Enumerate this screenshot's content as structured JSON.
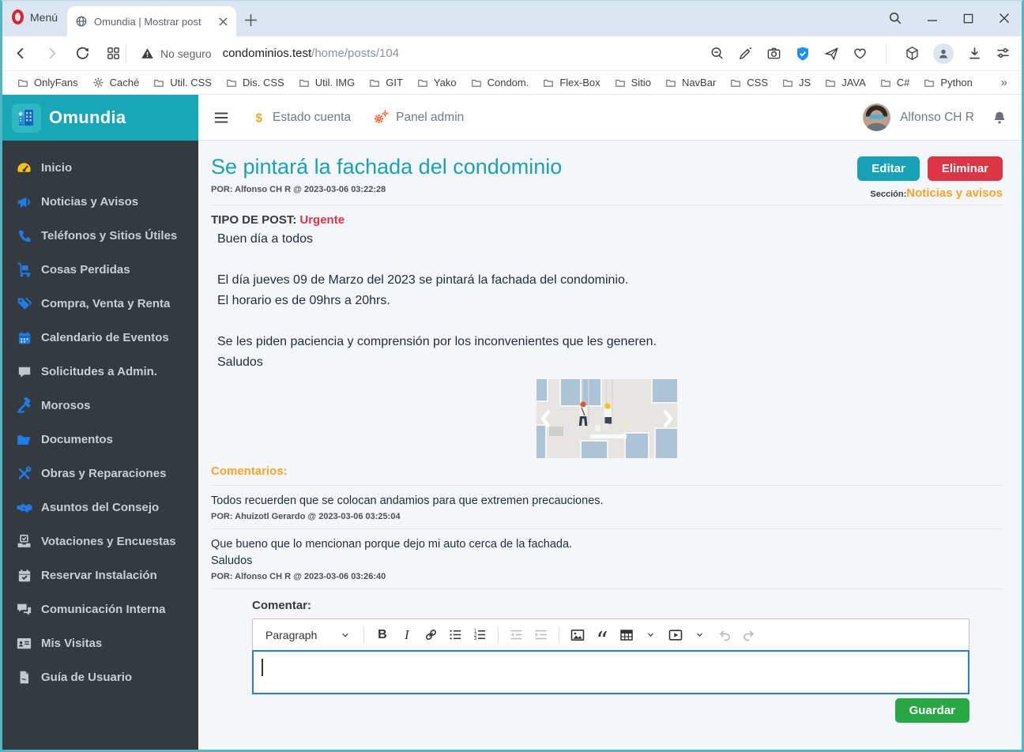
{
  "browser": {
    "menu_button": "Menú",
    "tab_title": "Omundia | Mostrar post",
    "security_label": "No seguro",
    "url_host": "condominios.test",
    "url_path": "/home/posts/104",
    "bookmarks": [
      "OnlyFans",
      "Caché",
      "Util. CSS",
      "Dis. CSS",
      "Util. IMG",
      "GIT",
      "Yako",
      "Condom.",
      "Flex-Box",
      "Sitio",
      "NavBar",
      "CSS",
      "JS",
      "JAVA",
      "C#",
      "Python"
    ],
    "bookmarks_overflow": "»"
  },
  "sidebar": {
    "brand": "Omundia",
    "items": [
      {
        "label": "Inicio"
      },
      {
        "label": "Noticias y Avisos"
      },
      {
        "label": "Teléfonos y Sitios Útiles"
      },
      {
        "label": "Cosas Perdidas"
      },
      {
        "label": "Compra, Venta y Renta"
      },
      {
        "label": "Calendario de Eventos"
      },
      {
        "label": "Solicitudes a Admin."
      },
      {
        "label": "Morosos"
      },
      {
        "label": "Documentos"
      },
      {
        "label": "Obras y Reparaciones"
      },
      {
        "label": "Asuntos del Consejo"
      },
      {
        "label": "Votaciones y Encuestas"
      },
      {
        "label": "Reservar Instalación"
      },
      {
        "label": "Comunicación Interna"
      },
      {
        "label": "Mis Visitas"
      },
      {
        "label": "Guía de Usuario"
      }
    ]
  },
  "navbar": {
    "links": [
      {
        "label": "Estado cuenta"
      },
      {
        "label": "Panel admin"
      }
    ],
    "user_name": "Alfonso CH R"
  },
  "post": {
    "title": "Se pintará la fachada del condominio",
    "byline": "POR: Alfonso CH R @ 2023-03-06 03:22:28",
    "edit_label": "Editar",
    "delete_label": "Eliminar",
    "section_label": "Sección:",
    "section_value": "Noticias y avisos",
    "type_label": "TIPO DE POST:",
    "type_value": "Urgente",
    "body_lines": [
      "Buen día a todos",
      "",
      "El día jueves 09 de Marzo del 2023 se pintará la fachada del condominio.",
      "El horario es de 09hrs a 20hrs.",
      "",
      "Se les piden paciencia y comprensión por los inconvenientes que les generen.",
      "Saludos"
    ]
  },
  "comments": {
    "title": "Comentarios:",
    "items": [
      {
        "line1": "Todos recuerden que se colocan andamios para que extremen precauciones.",
        "line2": "",
        "byline": "POR: Ahuizotl Gerardo @ 2023-03-06 03:25:04"
      },
      {
        "line1": "Que bueno que lo mencionan porque dejo mi auto cerca de la fachada.",
        "line2": "Saludos",
        "byline": "POR: Alfonso CH R @ 2023-03-06 03:26:40"
      }
    ]
  },
  "comment_form": {
    "label": "Comentar:",
    "heading_dropdown": "Paragraph",
    "save_label": "Guardar"
  },
  "colors": {
    "brand_teal": "#18a7b4",
    "accent_teal": "#17a2b8",
    "danger_red": "#dc3545",
    "success_green": "#28a745",
    "warning_orange": "#f7a528",
    "sidebar_bg": "#343a40",
    "icon_blue": "#1e7ce8",
    "icon_gray": "#c2c7d0",
    "shield_blue": "#1c92f2",
    "editor_focus_blue": "#2977ff"
  }
}
